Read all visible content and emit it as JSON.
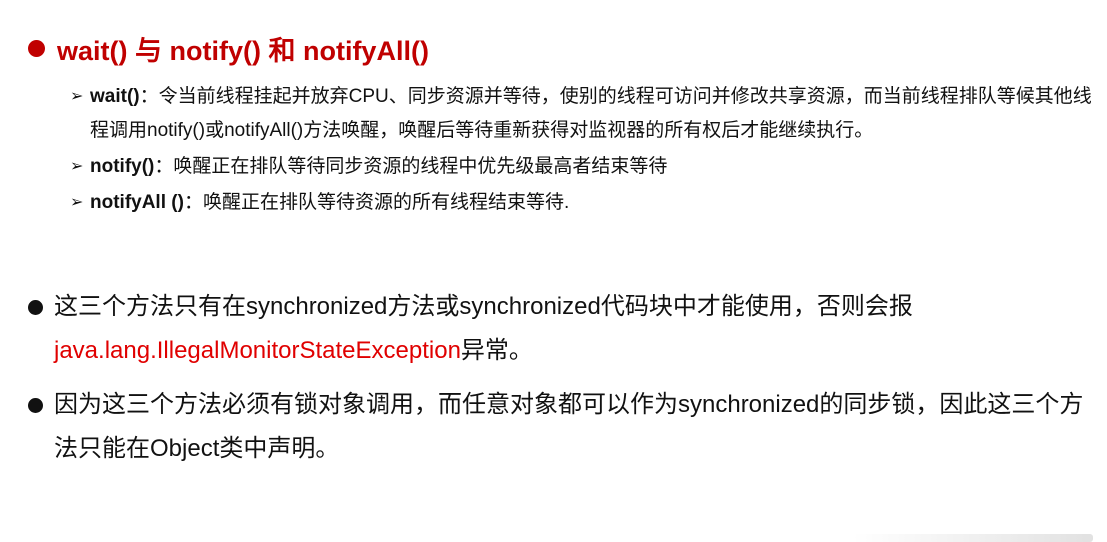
{
  "title": "wait() 与 notify() 和 notifyAll()",
  "colors": {
    "title": "#c00000",
    "exception": "#e00000",
    "text": "#111111"
  },
  "sub_items": [
    {
      "term": "wait()",
      "sep": "：",
      "text": "令当前线程挂起并放弃CPU、同步资源并等待，使别的线程可访问并修改共享资源，而当前线程排队等候其他线程调用notify()或notifyAll()方法唤醒，唤醒后等待重新获得对监视器的所有权后才能继续执行。"
    },
    {
      "term": "notify()",
      "sep": "：",
      "text": "唤醒正在排队等待同步资源的线程中优先级最高者结束等待"
    },
    {
      "term": "notifyAll ()",
      "sep": "：",
      "text": "唤醒正在排队等待资源的所有线程结束等待."
    }
  ],
  "main_items": [
    {
      "before": "这三个方法只有在synchronized方法或synchronized代码块中才能使用，否则会报",
      "exception": "java.lang.IllegalMonitorStateException",
      "after": "异常。"
    },
    {
      "text": "因为这三个方法必须有锁对象调用，而任意对象都可以作为synchronized的同步锁，因此这三个方法只能在Object类中声明。"
    }
  ]
}
